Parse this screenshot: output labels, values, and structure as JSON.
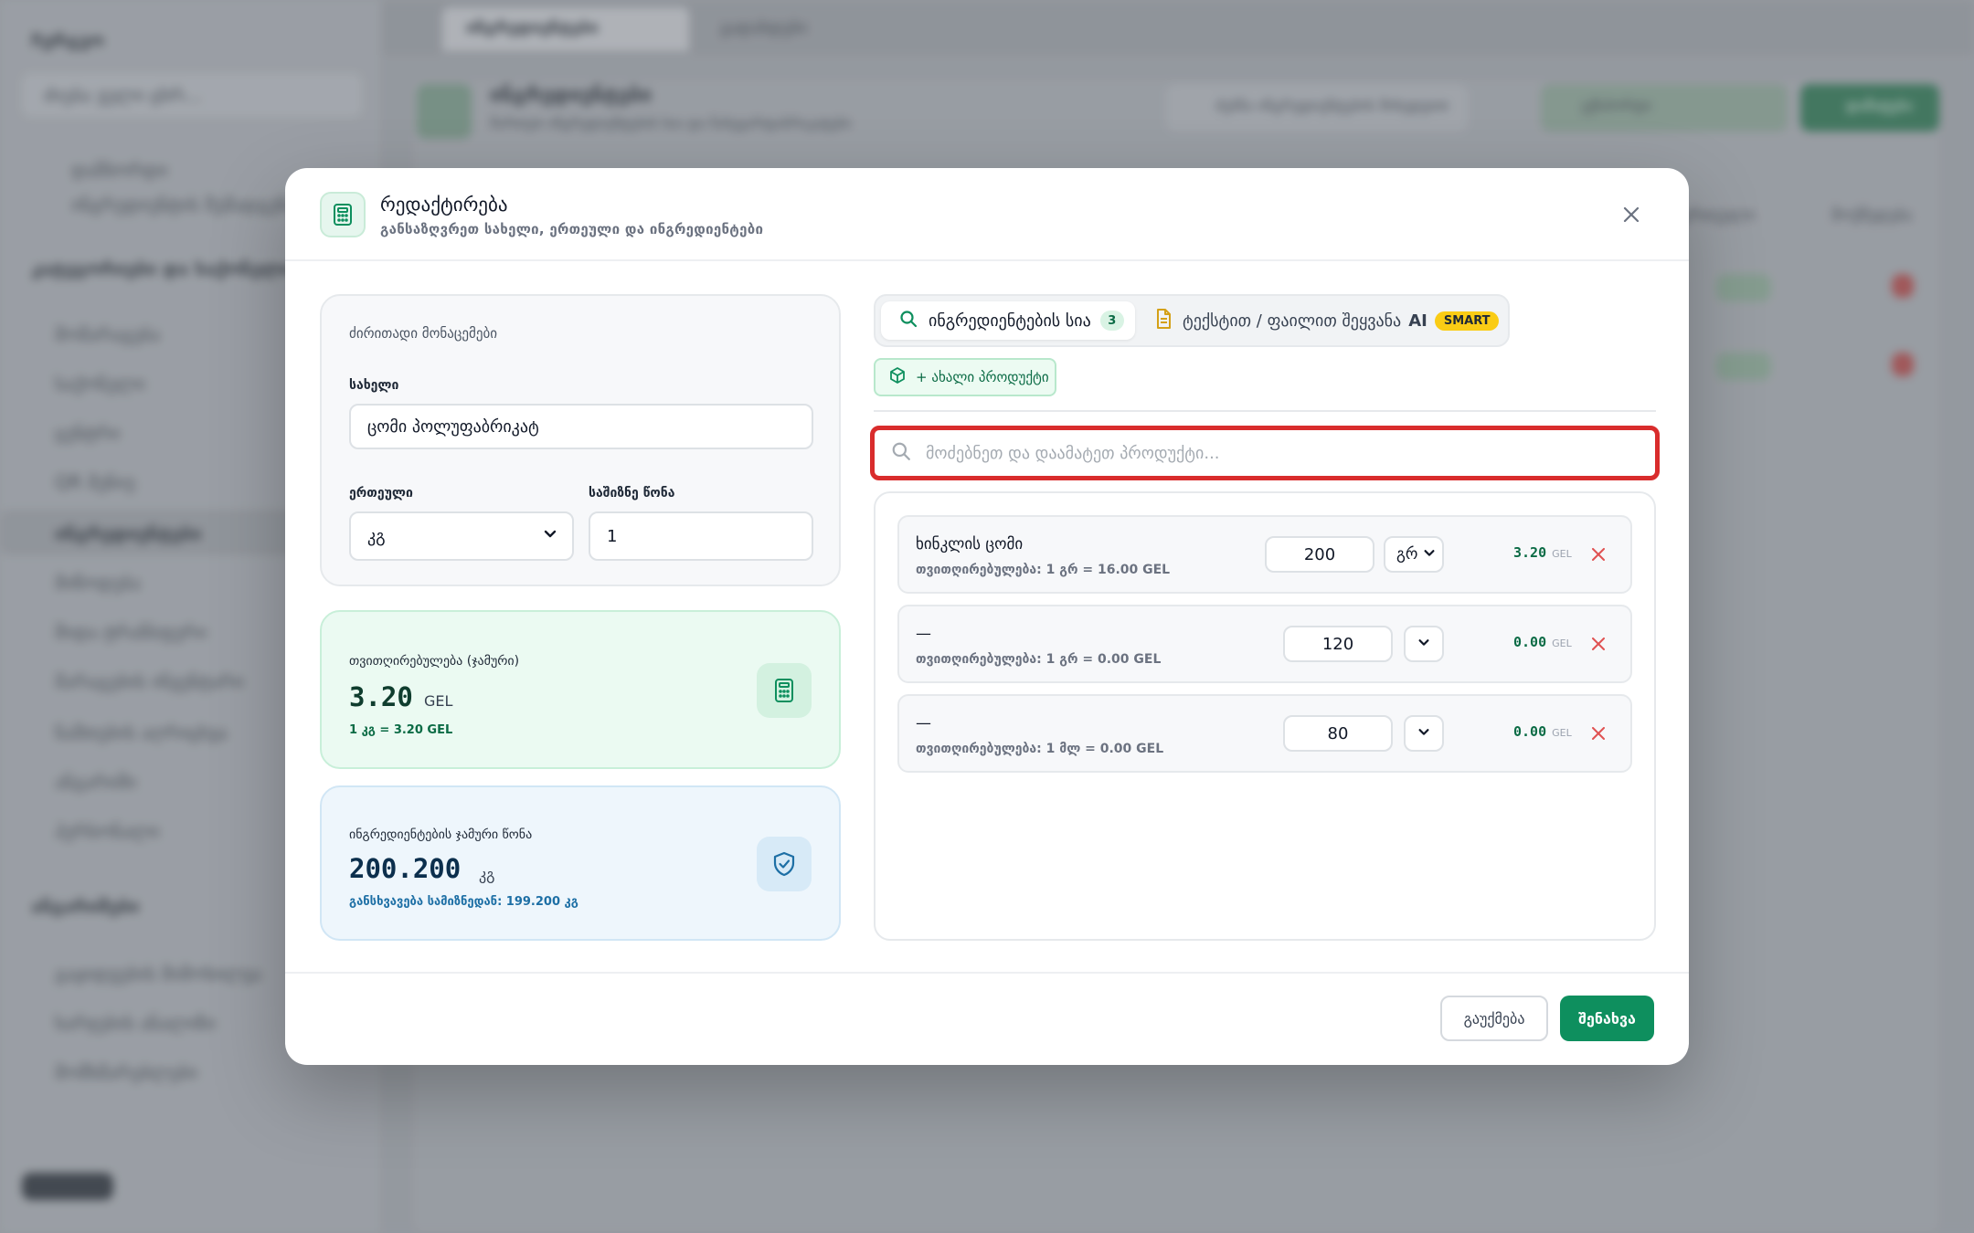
{
  "background": {
    "sidebar_top": "Ჩერგვო",
    "sidebar_search": "ძიება ველი ცხრ...",
    "sidebar_items": [
      "დაშბორდი",
      "ინგრედიენტის შემადგენლობა",
      "კატეგორიები და საქონელი",
      "მომარაგება",
      "საქონელი",
      "ცენტრი",
      "QR მენიუ",
      "ინგრედიენტები",
      "მიწოდება",
      "შიდა ტრანსფერი",
      "მარაგების ინვენტარი",
      "ნაშთების აღრიცხვა",
      "ანგარიში",
      "პერსონალი"
    ],
    "sidebar_section_2": "ანგარიშები",
    "sidebar_bottom_items": [
      "გაყიდვების მიმოხილვა",
      "ხარჯების ანალიზი",
      "მომხმარებლები"
    ],
    "tabs": [
      "ინგრედიენტები",
      "გადახდები"
    ],
    "page_title": "ინგრედიენტები",
    "page_subtitle": "მართეთ ინგრედიენტების სია და ნახევარფაბრიკატები",
    "top_search": "ძებნა ინგრედიენტების მიხედვით",
    "export_btn": "ექსპორტი",
    "add_btn": "დამატება",
    "col_headers": [
      "ერთეული",
      "მოქმედება"
    ]
  },
  "modal": {
    "title": "რედაქტირება",
    "subtitle": "განსაზღვრეთ სახელი, ერთეული და ინგრედიენტები",
    "basic_section": "ძირითადი მონაცემები",
    "name_label": "სახელი",
    "name_value": "ცომი პოლუფაბრიკატ",
    "unit_label": "ერთეული",
    "unit_value": "კგ",
    "weight_label": "საშიზნე წონა",
    "weight_value": "1",
    "cost_label": "თვითღირებულება (ჯამური)",
    "cost_value": "3.20",
    "cost_currency": "GEL",
    "cost_per_unit": "1 კგ = 3.20 GEL",
    "total_weight_label": "ინგრედიენტების ჯამური წონა",
    "total_weight_value": "200.200",
    "total_weight_unit": "კგ",
    "difference": "განსხვავება სამიზნედან: 199.200 კგ",
    "tab_list_label": "ინგრედიენტების სია",
    "tab_list_count": "3",
    "tab_text_label": "ტექსტით / ფაილით შეყვანა",
    "tab_ai": "AI",
    "tab_smart": "SMART",
    "new_product_btn": "+ ახალი პროდუქტი",
    "search_placeholder": "მოძებნეთ და დაამატეთ პროდუქტი...",
    "cancel_btn": "გაუქმება",
    "save_btn": "შენახვა"
  },
  "ingredients": [
    {
      "name": "ხინკლის ცომი",
      "cost_line": "თვითღირებულება: 1 გრ = 16.00 GEL",
      "qty": "200",
      "unit": "გრ",
      "cost": "3.20",
      "currency": "GEL"
    },
    {
      "name": "—",
      "cost_line": "თვითღირებულება: 1 გრ = 0.00 GEL",
      "qty": "120",
      "unit": "",
      "cost": "0.00",
      "currency": "GEL"
    },
    {
      "name": "—",
      "cost_line": "თვითღირებულება: 1 მლ = 0.00 GEL",
      "qty": "80",
      "unit": "",
      "cost": "0.00",
      "currency": "GEL"
    }
  ],
  "colors": {
    "accent_green": "#0e8f5e",
    "highlight_red": "#d92c2c",
    "smart_yellow": "#facc15"
  },
  "icons": [
    "calculator-icon",
    "close-icon",
    "search-icon",
    "document-icon",
    "cube-plus-icon",
    "chevron-down-icon",
    "shield-check-icon",
    "x-icon"
  ]
}
